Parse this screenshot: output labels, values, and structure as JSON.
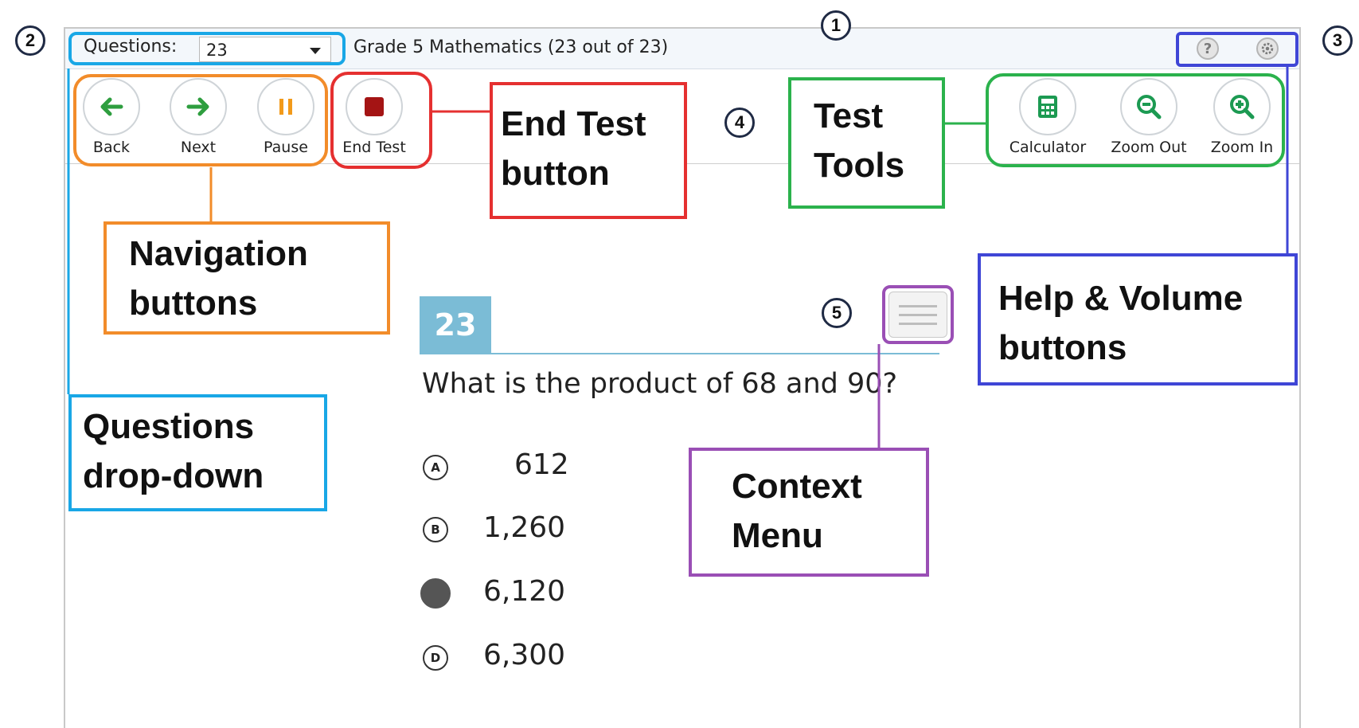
{
  "header": {
    "questions_label": "Questions:",
    "questions_value": "23",
    "test_title": "Grade 5 Mathematics (23 out of 23)"
  },
  "nav": {
    "back": "Back",
    "next": "Next",
    "pause": "Pause",
    "end_test": "End Test"
  },
  "tools": {
    "calculator": "Calculator",
    "zoom_out": "Zoom Out",
    "zoom_in": "Zoom In"
  },
  "question": {
    "number": "23",
    "text": "What is the product of 68 and 90?",
    "options": [
      {
        "letter": "A",
        "value": "612",
        "selected": false
      },
      {
        "letter": "B",
        "value": "1,260",
        "selected": false
      },
      {
        "letter": "C",
        "value": "6,120",
        "selected": true
      },
      {
        "letter": "D",
        "value": "6,300",
        "selected": false
      }
    ]
  },
  "annotations": {
    "badges": [
      "1",
      "2",
      "3",
      "4",
      "5"
    ],
    "end_test": [
      "End Test",
      "button"
    ],
    "test_tools": [
      "Test",
      "Tools"
    ],
    "navigation": [
      "Navigation",
      "buttons"
    ],
    "help_volume": [
      "Help & Volume",
      "buttons"
    ],
    "questions_dropdown": [
      "Questions",
      "drop-down"
    ],
    "context_menu": [
      "Context",
      "Menu"
    ]
  },
  "colors": {
    "nav_green": "#2e9e3f",
    "pause_orange": "#f29a1a",
    "end_red": "#a41414",
    "tool_green": "#1c9a52",
    "question_blue": "#7bbcd6",
    "callout_orange": "#f28c2a",
    "callout_red": "#e53030",
    "callout_green": "#2bb24c",
    "callout_blue": "#3f46d6",
    "callout_cyan": "#19a7e6",
    "callout_purple": "#9a4fb5"
  }
}
